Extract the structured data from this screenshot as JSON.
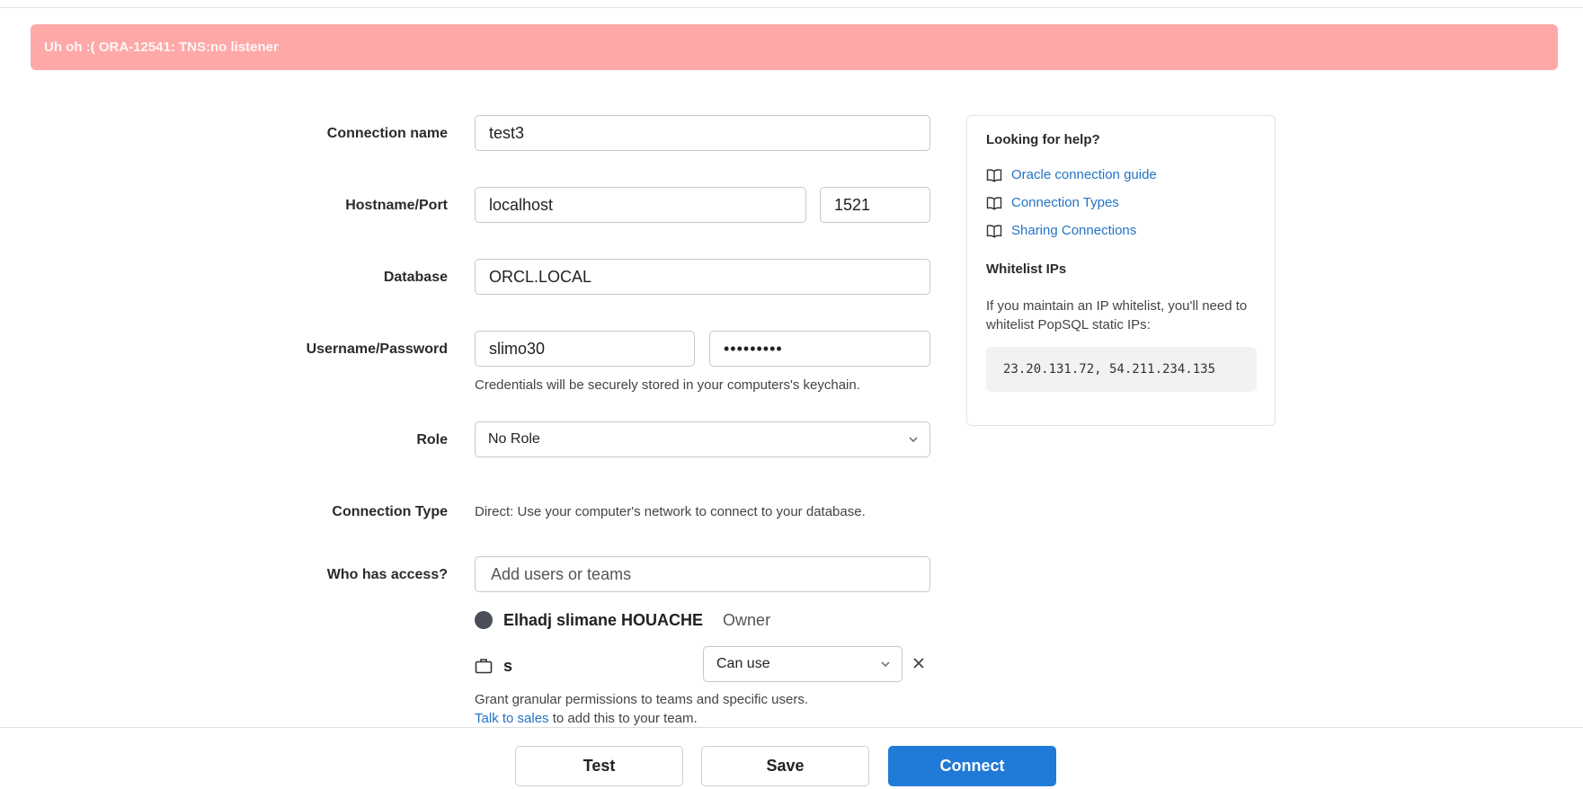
{
  "banner": {
    "error_text": "Uh oh :( ORA-12541: TNS:no listener"
  },
  "form": {
    "connection_name": {
      "label": "Connection name",
      "value": "test3"
    },
    "hostname_port": {
      "label": "Hostname/Port",
      "host_value": "localhost",
      "port_value": "1521"
    },
    "database": {
      "label": "Database",
      "value": "ORCL.LOCAL"
    },
    "credentials": {
      "label": "Username/Password",
      "username_value": "slimo30",
      "password_value": "•••••••••",
      "hint": "Credentials will be securely stored in your computers's keychain."
    },
    "role": {
      "label": "Role",
      "selected": "No Role"
    },
    "connection_type": {
      "label": "Connection Type",
      "value": "Direct: Use your computer's network to connect to your database."
    },
    "access": {
      "label": "Who has access?",
      "placeholder": "Add users or teams",
      "owner_name": "Elhadj slimane HOUACHE",
      "owner_role": "Owner",
      "team_name": "s",
      "team_permission": "Can use",
      "grant_text": "Grant granular permissions to teams and specific users.",
      "talk_link": "Talk to sales",
      "talk_suffix": " to add this to your team."
    }
  },
  "help": {
    "title": "Looking for help?",
    "links": [
      "Oracle connection guide",
      "Connection Types",
      "Sharing Connections"
    ],
    "whitelist_title": "Whitelist IPs",
    "whitelist_text": "If you maintain an IP whitelist, you'll need to whitelist PopSQL static IPs:",
    "ips": "23.20.131.72, 54.211.234.135"
  },
  "actions": {
    "test_label": "Test",
    "save_label": "Save",
    "connect_label": "Connect"
  },
  "colors": {
    "error_banner": "#ffa8a8",
    "primary": "#1f7ad8",
    "link": "#2474c4"
  },
  "icons": {
    "help_link_icon": "book-icon",
    "team_icon": "briefcase-icon",
    "owner_avatar": "avatar",
    "remove_icon": "close-icon",
    "dropdown_icon": "chevron-down-icon"
  }
}
